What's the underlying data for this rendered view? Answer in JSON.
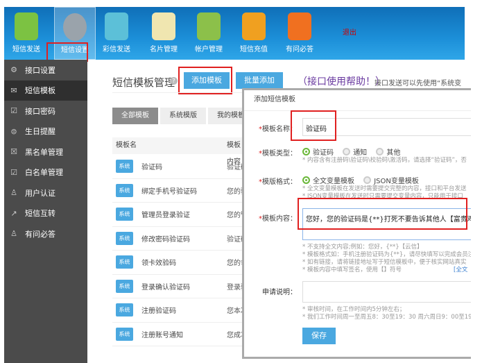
{
  "topnav": {
    "items": [
      {
        "label": "短信发送"
      },
      {
        "label": "短信设置"
      },
      {
        "label": "彩信发送"
      },
      {
        "label": "名片管理"
      },
      {
        "label": "帐户管理"
      },
      {
        "label": "短信充值"
      },
      {
        "label": "有问必答"
      }
    ],
    "logout": "退出"
  },
  "sidebar": {
    "items": [
      {
        "label": "接口设置",
        "icon": "gear-icon"
      },
      {
        "label": "短信模板",
        "icon": "envelope-icon"
      },
      {
        "label": "接口密码",
        "icon": "clipboard-check-icon"
      },
      {
        "label": "生日提醒",
        "icon": "cake-icon"
      },
      {
        "label": "黑名单管理",
        "icon": "clipboard-x-icon"
      },
      {
        "label": "白名单管理",
        "icon": "clipboard-check-icon"
      },
      {
        "label": "用户认证",
        "icon": "user-icon"
      },
      {
        "label": "短信互转",
        "icon": "external-link-icon"
      },
      {
        "label": "有问必答",
        "icon": "user-icon"
      }
    ]
  },
  "main": {
    "title": "短信模板管理",
    "add_button": "添加模板",
    "batch_button": "批量添加",
    "help_link": "（接口使用帮助！）",
    "help_text": "接口发送可以先使用“系统变",
    "tabs": [
      "全部模板",
      "系统模版",
      "我的模板"
    ],
    "columns": [
      "模板名",
      "模板内容"
    ],
    "rows": [
      {
        "badge": "系统",
        "name": "验证码",
        "content": "验证码"
      },
      {
        "badge": "系统",
        "name": "绑定手机号验证码",
        "content": "您的验"
      },
      {
        "badge": "系统",
        "name": "管理员登录验证",
        "content": "您的管"
      },
      {
        "badge": "系统",
        "name": "修改密码验证码",
        "content": "验证码"
      },
      {
        "badge": "系统",
        "name": "领卡效验码",
        "content": "您的领"
      },
      {
        "badge": "系统",
        "name": "登录确认验证码",
        "content": "登录验"
      },
      {
        "badge": "系统",
        "name": "注册验证码",
        "content": "您本次"
      },
      {
        "badge": "系统",
        "name": "注册账号通知",
        "content": "您成功"
      }
    ]
  },
  "modal": {
    "title": "添加短信模板",
    "name_label": "模板名称：",
    "name_value": "验证码",
    "type_label": "模板类型：",
    "type_options": [
      "验证码",
      "通知",
      "其他"
    ],
    "type_selected": "验证码",
    "type_hint": "* 内容含有注册码\\验证码\\校验码\\激活码，请选择“验证码”，否",
    "format_label": "模版格式：",
    "format_options": [
      "全文变量模板",
      "JSON变量模板"
    ],
    "format_selected": "全文变量模板",
    "format_hint1": "* 全文变量模板在发送时需要提交完整的内容，接口和平台发送",
    "format_hint2": "* JSON变量模板在发送时只需要提交变量内容，只能用于接口",
    "content_label": "模板内容：",
    "content_value": "您好，您的验证码是{**}打死不要告诉其他人【富贵鸡】",
    "content_hints": [
      "* 不支持全文内容;例如：您好，{**}【云信】",
      "* 模板格式如：手机注册验证码为{**}，请尽快填写以完成会员注",
      "* 如有链接，请将链接地址写于短信模板中，便于核实网站真实",
      "* 模板内容中填写签名，使用【】符号"
    ],
    "fulltext_link": "[全文",
    "desc_label": "申请说明：",
    "desc_value": "",
    "review_hints": [
      "* 审核时间，在工作时间内5分钟左右；",
      "* 我们工作时间周一至周五8：30至19：30 周六周日9：00至19"
    ],
    "save": "保存"
  }
}
